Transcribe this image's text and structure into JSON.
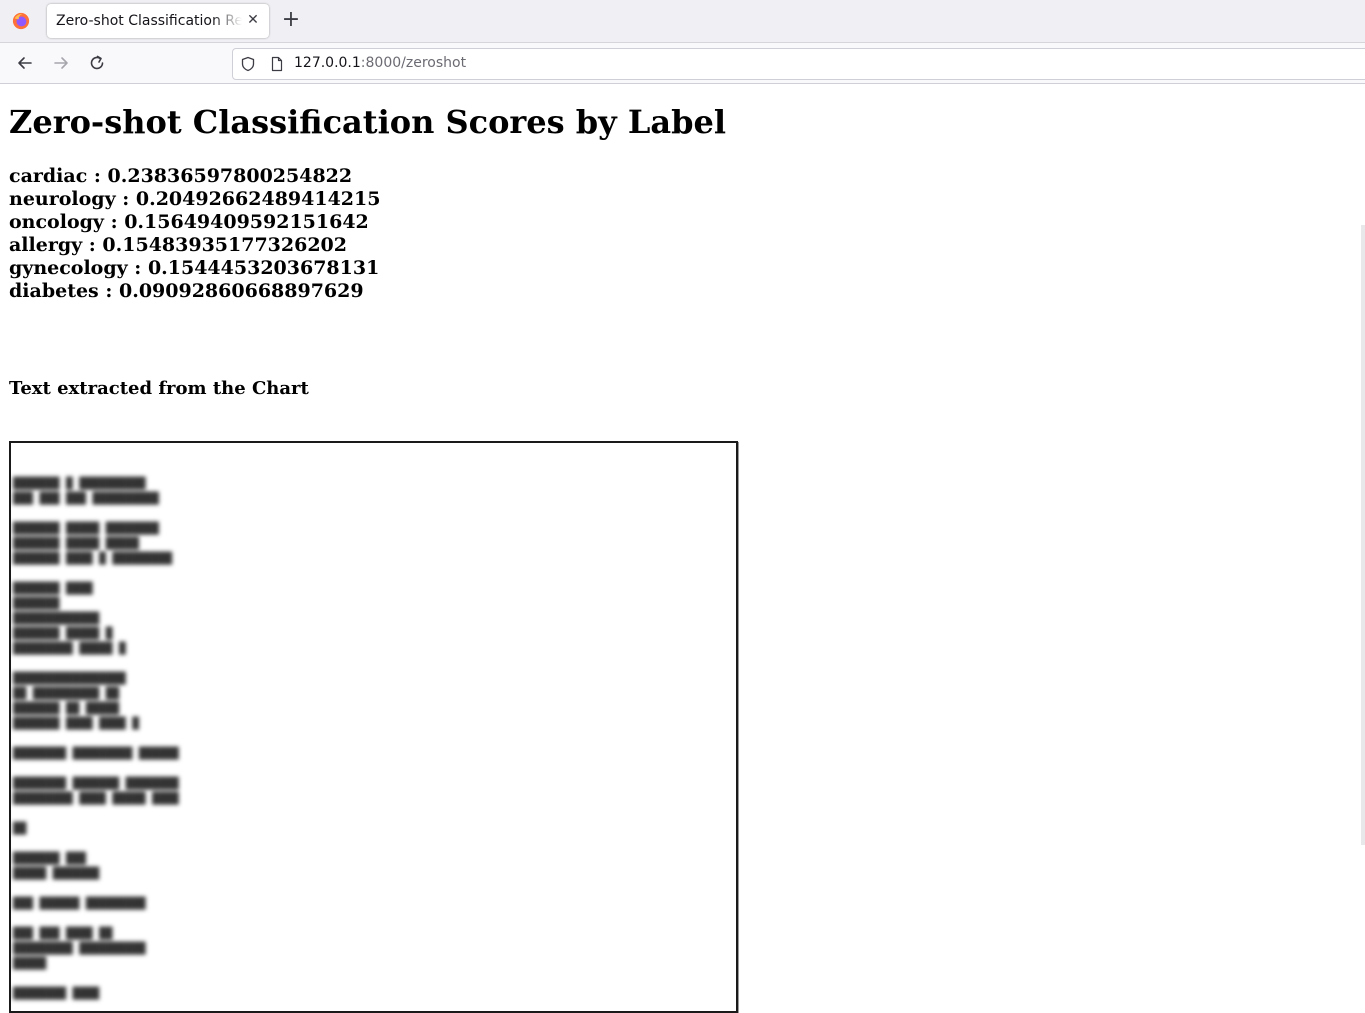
{
  "browser": {
    "tab_title": "Zero-shot Classification Results",
    "url_host": "127.0.0.1",
    "url_path": ":8000/zeroshot"
  },
  "page": {
    "title": "Zero-shot Classification Scores by Label",
    "scores": [
      {
        "label": "cardiac",
        "value": "0.23836597800254822"
      },
      {
        "label": "neurology",
        "value": "0.20492662489414215"
      },
      {
        "label": "oncology",
        "value": "0.15649409592151642"
      },
      {
        "label": "allergy",
        "value": "0.15483935177326202"
      },
      {
        "label": "gynecology",
        "value": "0.1544453203678131"
      },
      {
        "label": "diabetes",
        "value": "0.09092860668897629"
      }
    ],
    "section_heading": "Text extracted from the Chart"
  },
  "icons": {
    "app": "firefox-icon",
    "back": "back-arrow-icon",
    "forward": "forward-arrow-icon",
    "reload": "reload-icon",
    "shield": "shield-icon",
    "page": "page-icon",
    "close": "close-icon",
    "new_tab": "plus-icon"
  }
}
